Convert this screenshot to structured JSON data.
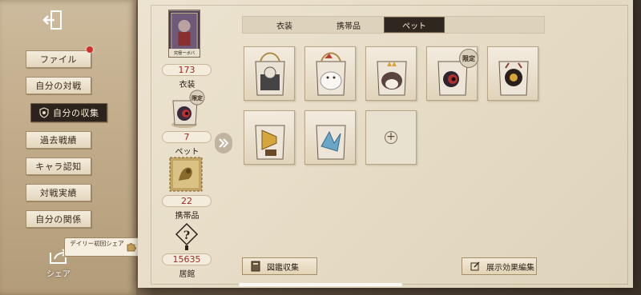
{
  "menu": {
    "items": [
      {
        "label": "ファイル",
        "active": false,
        "notification": true
      },
      {
        "label": "自分の対戦",
        "active": false
      },
      {
        "label": "自分の収集",
        "active": true
      },
      {
        "label": "過去戦績",
        "active": false
      },
      {
        "label": "キャラ認知",
        "active": false
      },
      {
        "label": "対戦実績",
        "active": false
      },
      {
        "label": "自分の関係",
        "active": false
      }
    ],
    "share_label": "シェア",
    "daily_tip": "デイリー初回シェア"
  },
  "stats": {
    "card_tag": "究極ーボバ",
    "costume": {
      "value": "173",
      "label": "衣装"
    },
    "pet": {
      "value": "7",
      "label": "ペット",
      "badge": "限定"
    },
    "accessory": {
      "value": "22",
      "label": "携帯品"
    },
    "residence": {
      "value": "15635",
      "label": "居館"
    }
  },
  "tabs": [
    {
      "label": "衣装",
      "active": false
    },
    {
      "label": "携帯品",
      "active": false
    },
    {
      "label": "ペット",
      "active": true
    }
  ],
  "pets": [
    {
      "name": "pet-cat-in-cage-1",
      "limited": false
    },
    {
      "name": "pet-white-cat",
      "limited": false
    },
    {
      "name": "pet-crowned-bird",
      "limited": false
    },
    {
      "name": "pet-eyeball-creature",
      "limited": true,
      "badge": "限定"
    },
    {
      "name": "pet-gold-eye-creature",
      "limited": false
    },
    {
      "name": "pet-gramophone",
      "limited": false
    },
    {
      "name": "pet-blue-bird",
      "limited": false
    }
  ],
  "buttons": {
    "catalog": "図鑑収集",
    "display_effect": "展示効果編集"
  },
  "colors": {
    "active_dark": "#2f271f",
    "stat_red": "#a02a22",
    "notification": "#d0302a"
  }
}
